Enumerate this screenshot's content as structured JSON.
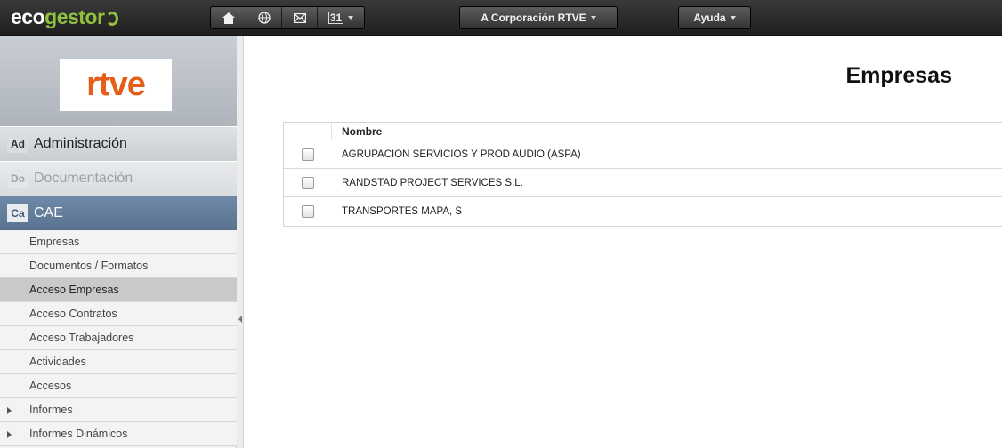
{
  "app": {
    "logo_part1": "eco",
    "logo_part2": "gestor"
  },
  "toolbar": {
    "icons": [
      "home-icon",
      "globe-icon",
      "mail-icon",
      "calendar-icon"
    ],
    "calendar_day": "31",
    "org_menu": "A Corporación RTVE",
    "help_menu": "Ayuda"
  },
  "sidebar": {
    "client_logo": "rtve",
    "modules": [
      {
        "code": "Ad",
        "label": "Administración"
      },
      {
        "code": "Do",
        "label": "Documentación"
      },
      {
        "code": "Ca",
        "label": "CAE"
      }
    ],
    "items": [
      {
        "label": "Empresas"
      },
      {
        "label": "Documentos / Formatos"
      },
      {
        "label": "Acceso Empresas",
        "active": true
      },
      {
        "label": "Acceso Contratos"
      },
      {
        "label": "Acceso Trabajadores"
      },
      {
        "label": "Actividades"
      },
      {
        "label": "Accesos"
      },
      {
        "label": "Informes",
        "expandable": true
      },
      {
        "label": "Informes Dinámicos",
        "expandable": true
      }
    ]
  },
  "main": {
    "title": "Empresas",
    "table": {
      "column": "Nombre",
      "rows": [
        "AGRUPACION SERVICIOS Y PROD AUDIO (ASPA)",
        "RANDSTAD PROJECT SERVICES S.L.",
        "TRANSPORTES MAPA, S"
      ]
    }
  },
  "colors": {
    "brand_green": "#8fc23e",
    "rtve_orange": "#e35f18",
    "cae_blue": "#5f7a98"
  }
}
